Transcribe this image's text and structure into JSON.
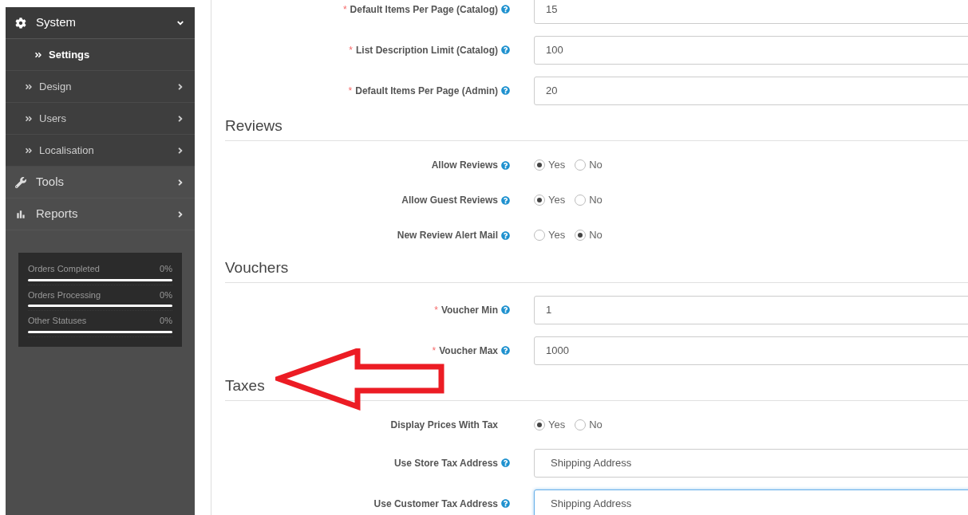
{
  "sidebar": {
    "menu": [
      {
        "label": "System",
        "expanded": true,
        "children": [
          {
            "label": "Settings",
            "selected": true,
            "has_submenu": false
          },
          {
            "label": "Design",
            "selected": false,
            "has_submenu": true
          },
          {
            "label": "Users",
            "selected": false,
            "has_submenu": true
          },
          {
            "label": "Localisation",
            "selected": false,
            "has_submenu": true
          }
        ]
      },
      {
        "label": "Tools",
        "expanded": false
      },
      {
        "label": "Reports",
        "expanded": false
      }
    ],
    "stats": [
      {
        "label": "Orders Completed",
        "value": "0%",
        "level": 0
      },
      {
        "label": "Orders Processing",
        "value": "0%",
        "level": 0
      },
      {
        "label": "Other Statuses",
        "value": "0%",
        "level": 0
      }
    ]
  },
  "sections": [
    {
      "fields": [
        {
          "kind": "text",
          "label": "Default Items Per Page (Catalog)",
          "required_mark": "*",
          "help": true,
          "value": "15",
          "focused": false
        },
        {
          "kind": "text",
          "label": "List Description Limit (Catalog)",
          "required_mark": "*",
          "help": true,
          "value": "100",
          "focused": false
        },
        {
          "kind": "text",
          "label": "Default Items Per Page (Admin)",
          "required_mark": "*",
          "help": true,
          "value": "20",
          "focused": false
        }
      ]
    },
    {
      "title": "Reviews",
      "fields": [
        {
          "kind": "radio",
          "label": "Allow Reviews",
          "help": true,
          "options": [
            {
              "label": "Yes",
              "selected": true
            },
            {
              "label": "No",
              "selected": false
            }
          ]
        },
        {
          "kind": "radio",
          "label": "Allow Guest Reviews",
          "help": true,
          "options": [
            {
              "label": "Yes",
              "selected": true
            },
            {
              "label": "No",
              "selected": false
            }
          ]
        },
        {
          "kind": "radio",
          "label": "New Review Alert Mail",
          "help": true,
          "options": [
            {
              "label": "Yes",
              "selected": false
            },
            {
              "label": "No",
              "selected": true
            }
          ]
        }
      ]
    },
    {
      "title": "Vouchers",
      "fields": [
        {
          "kind": "text",
          "label": "Voucher Min",
          "required_mark": "*",
          "help": true,
          "value": "1",
          "focused": false
        },
        {
          "kind": "text",
          "label": "Voucher Max",
          "required_mark": "*",
          "help": true,
          "value": "1000",
          "focused": false
        }
      ]
    },
    {
      "title": "Taxes",
      "fields": [
        {
          "kind": "radio",
          "label": "Display Prices With Tax",
          "help": false,
          "options": [
            {
              "label": "Yes",
              "selected": true
            },
            {
              "label": "No",
              "selected": false
            }
          ]
        },
        {
          "kind": "select",
          "label": "Use Store Tax Address",
          "help": true,
          "value": "Shipping Address",
          "focused": false
        },
        {
          "kind": "select",
          "label": "Use Customer Tax Address",
          "help": true,
          "value": "Shipping Address",
          "focused": true
        }
      ]
    }
  ]
}
